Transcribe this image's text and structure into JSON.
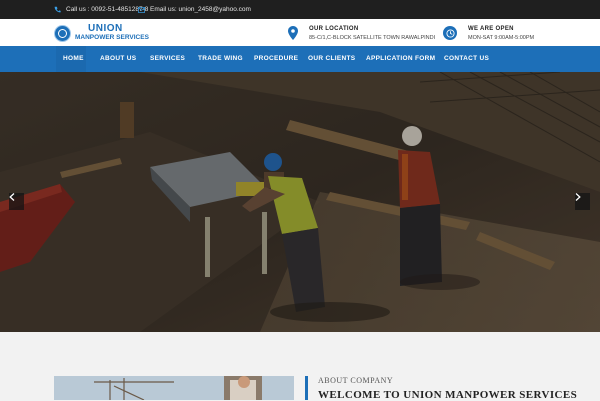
{
  "topbar": {
    "phone": "Call us : 0092-51-4851287-8",
    "email": "Email us: union_2458@yahoo.com",
    "phone_icon": "phone-icon",
    "email_icon": "envelope-icon"
  },
  "header": {
    "logo_line1": "UNION",
    "logo_line2": "MANPOWER SERVICES",
    "location_title": "OUR LOCATION",
    "location_text": "85-C/1,C-BLOCK SATELLITE TOWN RAWALPINDI",
    "hours_title": "WE ARE OPEN",
    "hours_text": "MON-SAT 9:00AM-5:00PM"
  },
  "nav": {
    "items": [
      {
        "label": "HOME",
        "active": true
      },
      {
        "label": "ABOUT US"
      },
      {
        "label": "SERVICES"
      },
      {
        "label": "TRADE WING"
      },
      {
        "label": "PROCEDURE"
      },
      {
        "label": "OUR CLIENTS"
      },
      {
        "label": "APPLICATION FORM"
      },
      {
        "label": "CONTACT US"
      }
    ]
  },
  "hero": {
    "prev_icon": "chevron-left-icon",
    "next_icon": "chevron-right-icon"
  },
  "about": {
    "kicker": "ABOUT COMPANY",
    "title": "WELCOME TO UNION MANPOWER SERVICES"
  },
  "colors": {
    "brand_blue": "#1d6fb8",
    "topbar_bg": "#1f1f1f",
    "page_bg": "#f2f2f2"
  }
}
